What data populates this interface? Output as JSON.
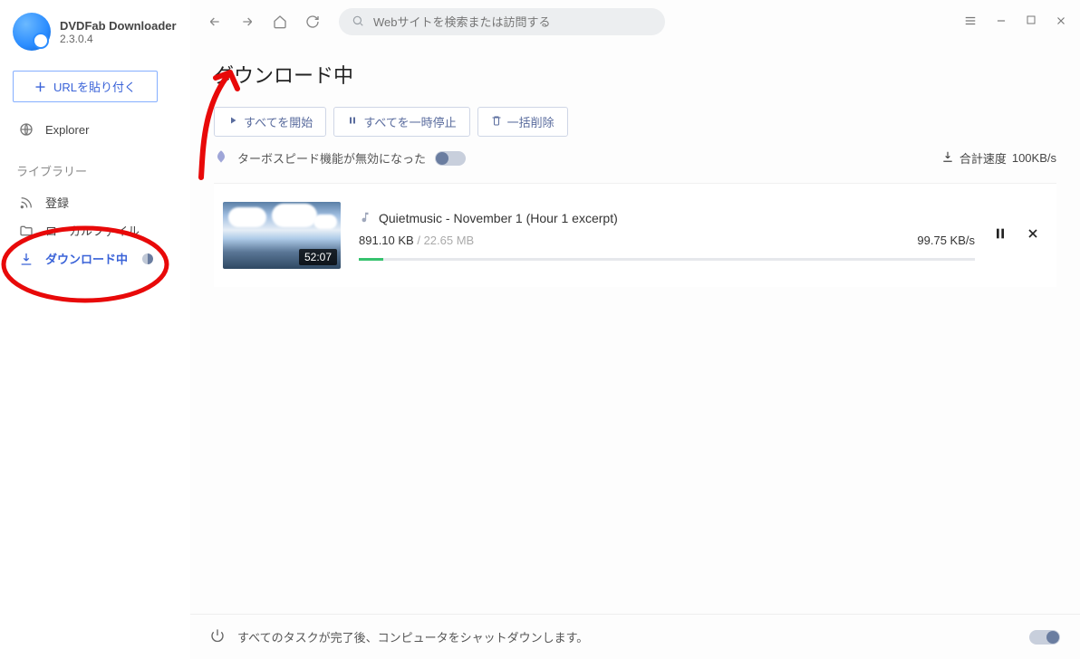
{
  "app": {
    "name": "DVDFab Downloader",
    "version": "2.3.0.4"
  },
  "sidebar": {
    "paste_url_label": "URLを貼り付く",
    "explorer_label": "Explorer",
    "library_section": "ライブラリー",
    "items": {
      "subscribe": "登録",
      "local_files": "ローカルファイル",
      "downloading": "ダウンロード中"
    }
  },
  "topbar": {
    "search_placeholder": "Webサイトを検索または訪問する"
  },
  "page": {
    "title": "ダウンロード中",
    "start_all": "すべてを開始",
    "pause_all": "すべてを一時停止",
    "delete_all": "一括削除",
    "turbo_label": "ターボスピード機能が無効になった",
    "total_speed_label": "合計速度",
    "total_speed_value": "100KB/s"
  },
  "downloads": [
    {
      "title": "Quietmusic - November 1 (Hour 1 excerpt)",
      "duration": "52:07",
      "downloaded": "891.10 KB",
      "total": "22.65 MB",
      "speed": "99.75 KB/s",
      "progress_percent": 4
    }
  ],
  "footer": {
    "shutdown_label": "すべてのタスクが完了後、コンピュータをシャットダウンします。"
  }
}
